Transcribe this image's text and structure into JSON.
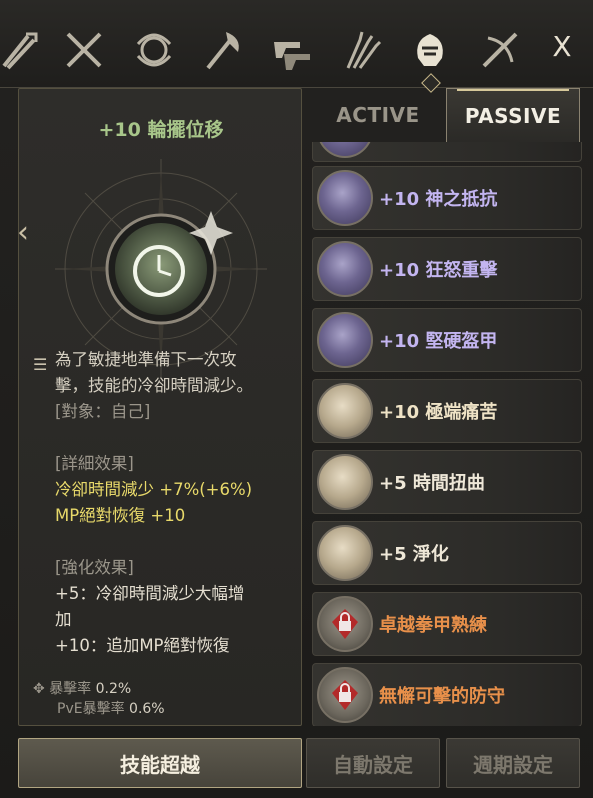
{
  "top_bar": {
    "class_icons": [
      "crossed-swords-icon",
      "crossed-blades-icon",
      "orb-icon",
      "axe-icon",
      "dual-guns-icon",
      "claw-icon",
      "fist-helm-icon",
      "crossbow-icon"
    ],
    "active_class_index": 6,
    "close_label": "X"
  },
  "detail": {
    "title": "+10 輪擺位移",
    "description_lines": [
      "為了敏捷地準備下一次攻",
      "擊，技能的冷卻時間減少。",
      "[對象：自己]"
    ],
    "detail_header": "[詳細效果]",
    "detail_lines": [
      "冷卻時間減少 +7%(+6%)",
      "MP絕對恢復 +10"
    ],
    "enhance_header": "[強化效果]",
    "enhance_lines": [
      "+5：冷卻時間減少大幅增",
      "加",
      "+10：追加MP絕對恢復"
    ],
    "stats": [
      {
        "label": "暴擊率",
        "value": "0.2%"
      },
      {
        "label": "PvE暴擊率",
        "value": "0.6%"
      }
    ]
  },
  "tabs": {
    "active": "ACTIVE",
    "passive": "PASSIVE"
  },
  "skills": [
    {
      "label": "+10 神之抵抗",
      "style": "purple"
    },
    {
      "label": "+10 狂怒重擊",
      "style": "purple"
    },
    {
      "label": "+10 堅硬盔甲",
      "style": "purple"
    },
    {
      "label": "+10 極端痛苦",
      "style": "beige"
    },
    {
      "label": "+5 時間扭曲",
      "style": "white"
    },
    {
      "label": "+5 淨化",
      "style": "white"
    },
    {
      "label": "卓越拳甲熟練",
      "style": "orange"
    },
    {
      "label": "無懈可擊的防守",
      "style": "orange"
    }
  ],
  "buttons": {
    "transcend": "技能超越",
    "auto_set": "自動設定",
    "period_set": "週期設定"
  }
}
